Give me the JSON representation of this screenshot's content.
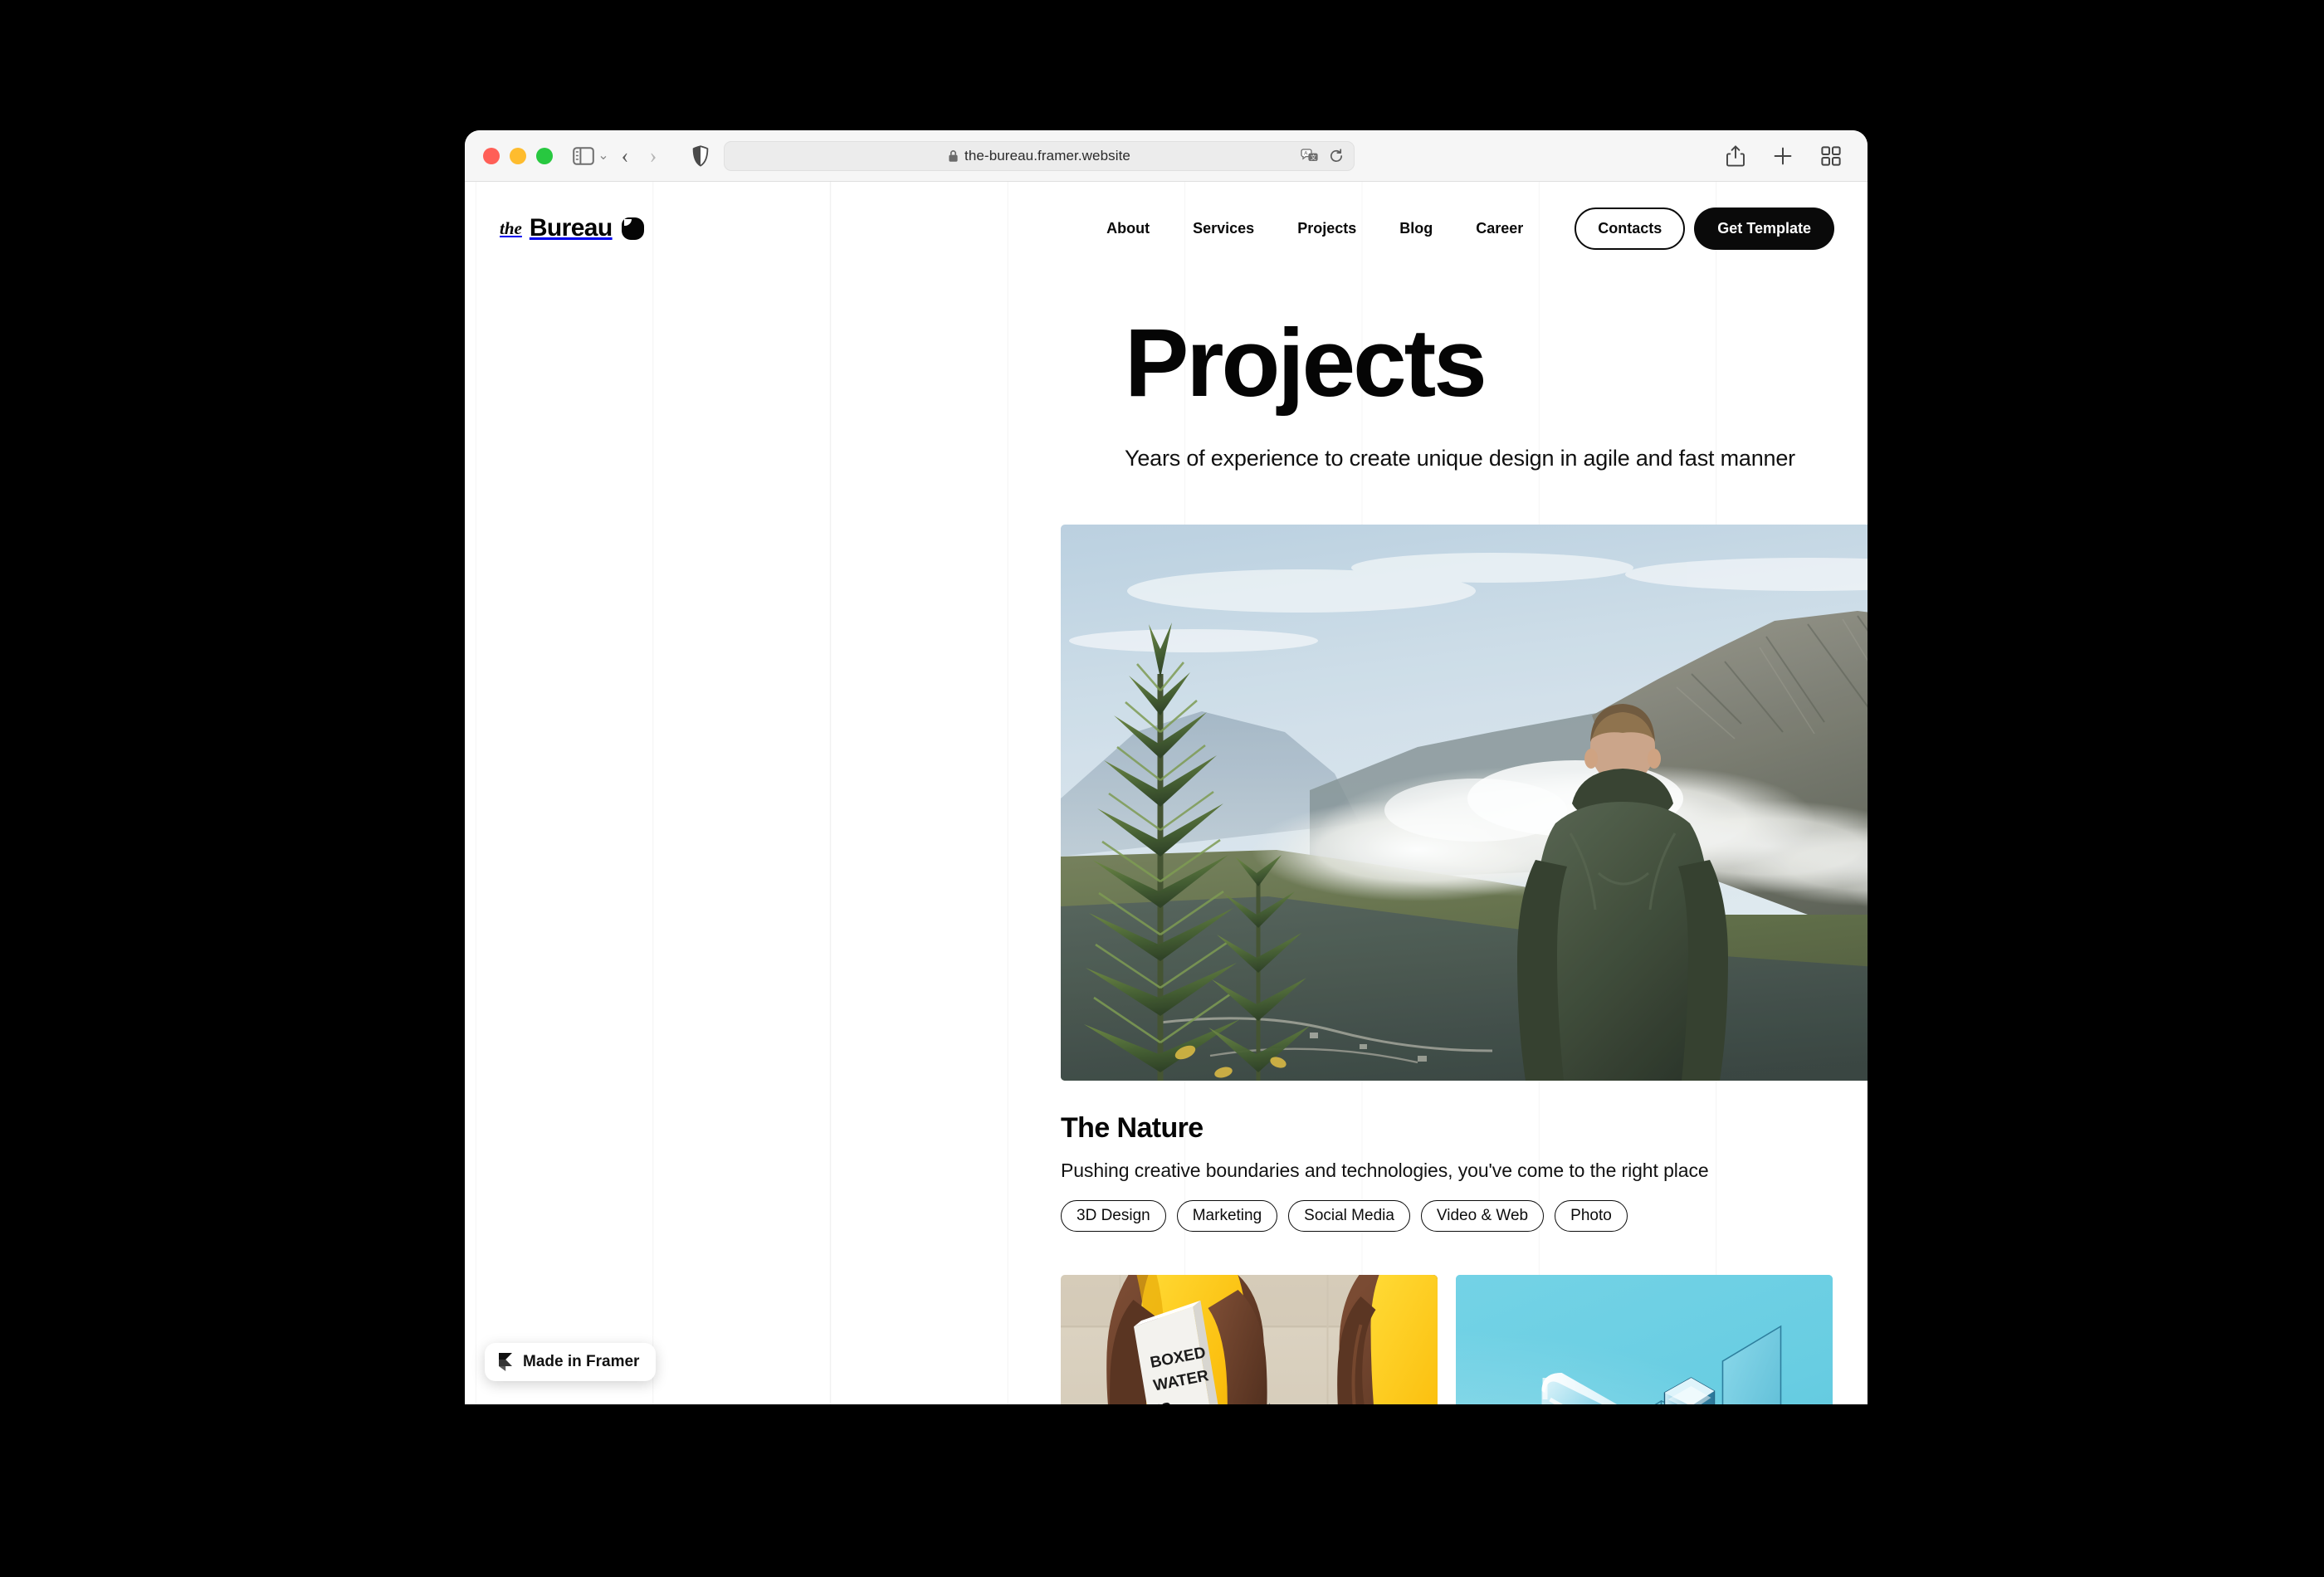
{
  "browser": {
    "traffic_lights": [
      {
        "name": "close",
        "color": "#FF5F57"
      },
      {
        "name": "minimize",
        "color": "#FEBC2E"
      },
      {
        "name": "zoom",
        "color": "#28C840"
      }
    ],
    "address": {
      "url": "the-bureau.framer.website",
      "lock_icon": "lock-icon",
      "translate_icon": "translate-icon",
      "reload_icon": "reload-icon"
    },
    "controls": {
      "sidebar_icon": "sidebar-toggle-icon",
      "sidebar_chevron": "chevron-down-icon",
      "back_icon": "back-arrow-icon",
      "forward_icon": "forward-arrow-icon",
      "shield_icon": "privacy-shield-icon",
      "share_icon": "share-icon",
      "new_tab_icon": "plus-icon",
      "tab_overview_icon": "tab-overview-icon"
    }
  },
  "site": {
    "logo": {
      "prefix": "the",
      "name": "Bureau",
      "mark": "logo-mark-icon"
    },
    "nav": [
      {
        "label": "About"
      },
      {
        "label": "Services"
      },
      {
        "label": "Projects"
      },
      {
        "label": "Blog"
      },
      {
        "label": "Career"
      }
    ],
    "actions": {
      "contacts": "Contacts",
      "get_template": "Get Template"
    },
    "hero": {
      "title": "Projects",
      "subtitle": "Years of experience to create unique design in agile and fast manner"
    },
    "projects": [
      {
        "image": "mountain-hiker-photo",
        "title": "The Nature",
        "description": "Pushing creative boundaries and technologies, you've come to the right place",
        "tags": [
          "3D Design",
          "Marketing",
          "Social Media",
          "Video & Web",
          "Photo"
        ]
      },
      {
        "image": "athletes-boxed-water-photo"
      },
      {
        "image": "cyan-3d-glass-render"
      }
    ],
    "badge": {
      "label": "Made in Framer",
      "icon": "framer-logo-icon"
    }
  },
  "colors": {
    "accent_dark": "#0a0a0a",
    "page_bg": "#ffffff",
    "toolbar_bg": "#f6f6f6",
    "cyan_card": "#6DCFE4",
    "desktop_bg": "#000000"
  }
}
